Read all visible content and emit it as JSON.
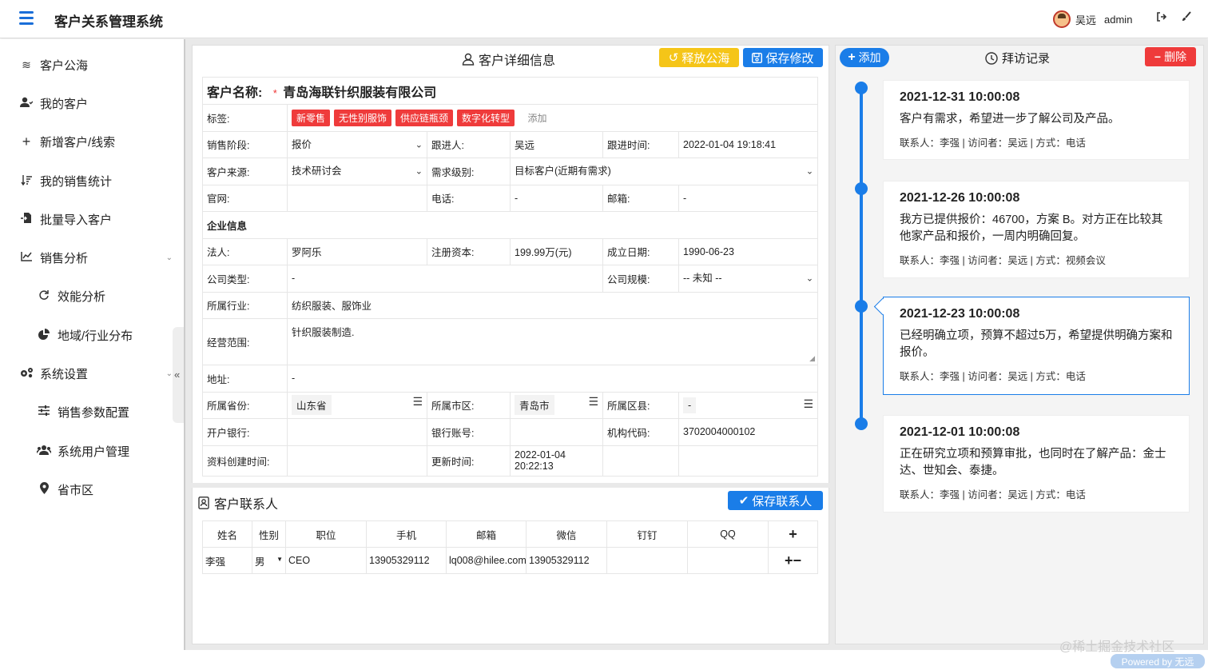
{
  "header": {
    "app_title": "客户关系管理系统",
    "user_name": "吴远",
    "user_role": "admin"
  },
  "sidebar": {
    "items": [
      {
        "label": "客户公海",
        "icon": "waves-icon"
      },
      {
        "label": "我的客户",
        "icon": "user-icon"
      },
      {
        "label": "新增客户/线索",
        "icon": "plus-icon"
      },
      {
        "label": "我的销售统计",
        "icon": "sort-icon"
      },
      {
        "label": "批量导入客户",
        "icon": "file-import-icon"
      },
      {
        "label": "销售分析",
        "icon": "chart-line-icon"
      },
      {
        "label": "效能分析",
        "icon": "refresh-icon"
      },
      {
        "label": "地域/行业分布",
        "icon": "pie-icon"
      },
      {
        "label": "系统设置",
        "icon": "cogs-icon"
      },
      {
        "label": "销售参数配置",
        "icon": "sliders-icon"
      },
      {
        "label": "系统用户管理",
        "icon": "users-icon"
      },
      {
        "label": "省市区",
        "icon": "map-marker-icon"
      }
    ]
  },
  "detail": {
    "title": "客户详细信息",
    "release_btn": "释放公海",
    "save_btn": "保存修改",
    "customer_name_label": "客户名称:",
    "required_mark": "*",
    "customer_name": "青岛海联针织服装有限公司",
    "tags_label": "标签:",
    "tags": [
      "新零售",
      "无性别服饰",
      "供应链瓶颈",
      "数字化转型"
    ],
    "tag_add": "添加",
    "stage_label": "销售阶段:",
    "stage_value": "报价",
    "follower_label": "跟进人:",
    "follower_value": "吴远",
    "follow_time_label": "跟进时间:",
    "follow_time_value": "2022-01-04 19:18:41",
    "source_label": "客户来源:",
    "source_value": "技术研讨会",
    "level_label": "需求级别:",
    "level_value": "目标客户(近期有需求)",
    "website_label": "官网:",
    "website_value": "",
    "phone_label": "电话:",
    "phone_value": "-",
    "email_label": "邮箱:",
    "email_value": "-",
    "enterprise_section": "企业信息",
    "legal_label": "法人:",
    "legal_value": "罗阿乐",
    "capital_label": "注册资本:",
    "capital_value": "199.99万(元)",
    "founded_label": "成立日期:",
    "founded_value": "1990-06-23",
    "company_type_label": "公司类型:",
    "company_type_value": "-",
    "scale_label": "公司规模:",
    "scale_value": "-- 未知 --",
    "industry_label": "所属行业:",
    "industry_value": "纺织服装、服饰业",
    "scope_label": "经营范围:",
    "scope_value": "针织服装制造.",
    "address_label": "地址:",
    "address_value": "-",
    "province_label": "所属省份:",
    "province_value": "山东省",
    "city_label": "所属市区:",
    "city_value": "青岛市",
    "district_label": "所属区县:",
    "district_value": "-",
    "bank_label": "开户银行:",
    "bank_value": "",
    "account_label": "银行账号:",
    "account_value": "",
    "org_code_label": "机构代码:",
    "org_code_value": "3702004000102",
    "created_label": "资料创建时间:",
    "created_value": "",
    "updated_label": "更新时间:",
    "updated_value_date": "2022-01-04",
    "updated_value_time": "20:22:13"
  },
  "contacts": {
    "title": "客户联系人",
    "save_btn": "保存联系人",
    "columns": [
      "姓名",
      "性别",
      "职位",
      "手机",
      "邮箱",
      "微信",
      "钉钉",
      "QQ"
    ],
    "add_symbol": "+",
    "rows": [
      {
        "name": "李强",
        "gender": "男",
        "position": "CEO",
        "mobile": "13905329112",
        "email": "lq008@hilee.com",
        "wechat": "13905329112",
        "dingtalk": "",
        "qq": ""
      }
    ],
    "row_actions": "+−"
  },
  "visits": {
    "add_btn": "添加",
    "title": "拜访记录",
    "delete_btn": "删除",
    "records": [
      {
        "time": "2021-12-31 10:00:08",
        "text": "客户有需求，希望进一步了解公司及产品。",
        "meta": "联系人：李强 | 访问者：吴远 | 方式：电话"
      },
      {
        "time": "2021-12-26 10:00:08",
        "text": "我方已提供报价：46700，方案 B。对方正在比较其他家产品和报价，一周内明确回复。",
        "meta": "联系人：李强 | 访问者：吴远 | 方式：视频会议"
      },
      {
        "time": "2021-12-23 10:00:08",
        "text": "已经明确立项，预算不超过5万，希望提供明确方案和报价。",
        "meta": "联系人：李强 | 访问者：吴远 | 方式：电话"
      },
      {
        "time": "2021-12-01 10:00:08",
        "text": "正在研究立项和预算审批，也同时在了解产品：金士达、世知会、泰捷。",
        "meta": "联系人：李强 | 访问者：吴远 | 方式：电话"
      }
    ]
  },
  "footer": {
    "watermark": "@稀土掘金技术社区",
    "powered": "Powered by 无远"
  },
  "colors": {
    "primary": "#1a7de8",
    "warning": "#f5c518",
    "danger": "#ef3b3b"
  }
}
